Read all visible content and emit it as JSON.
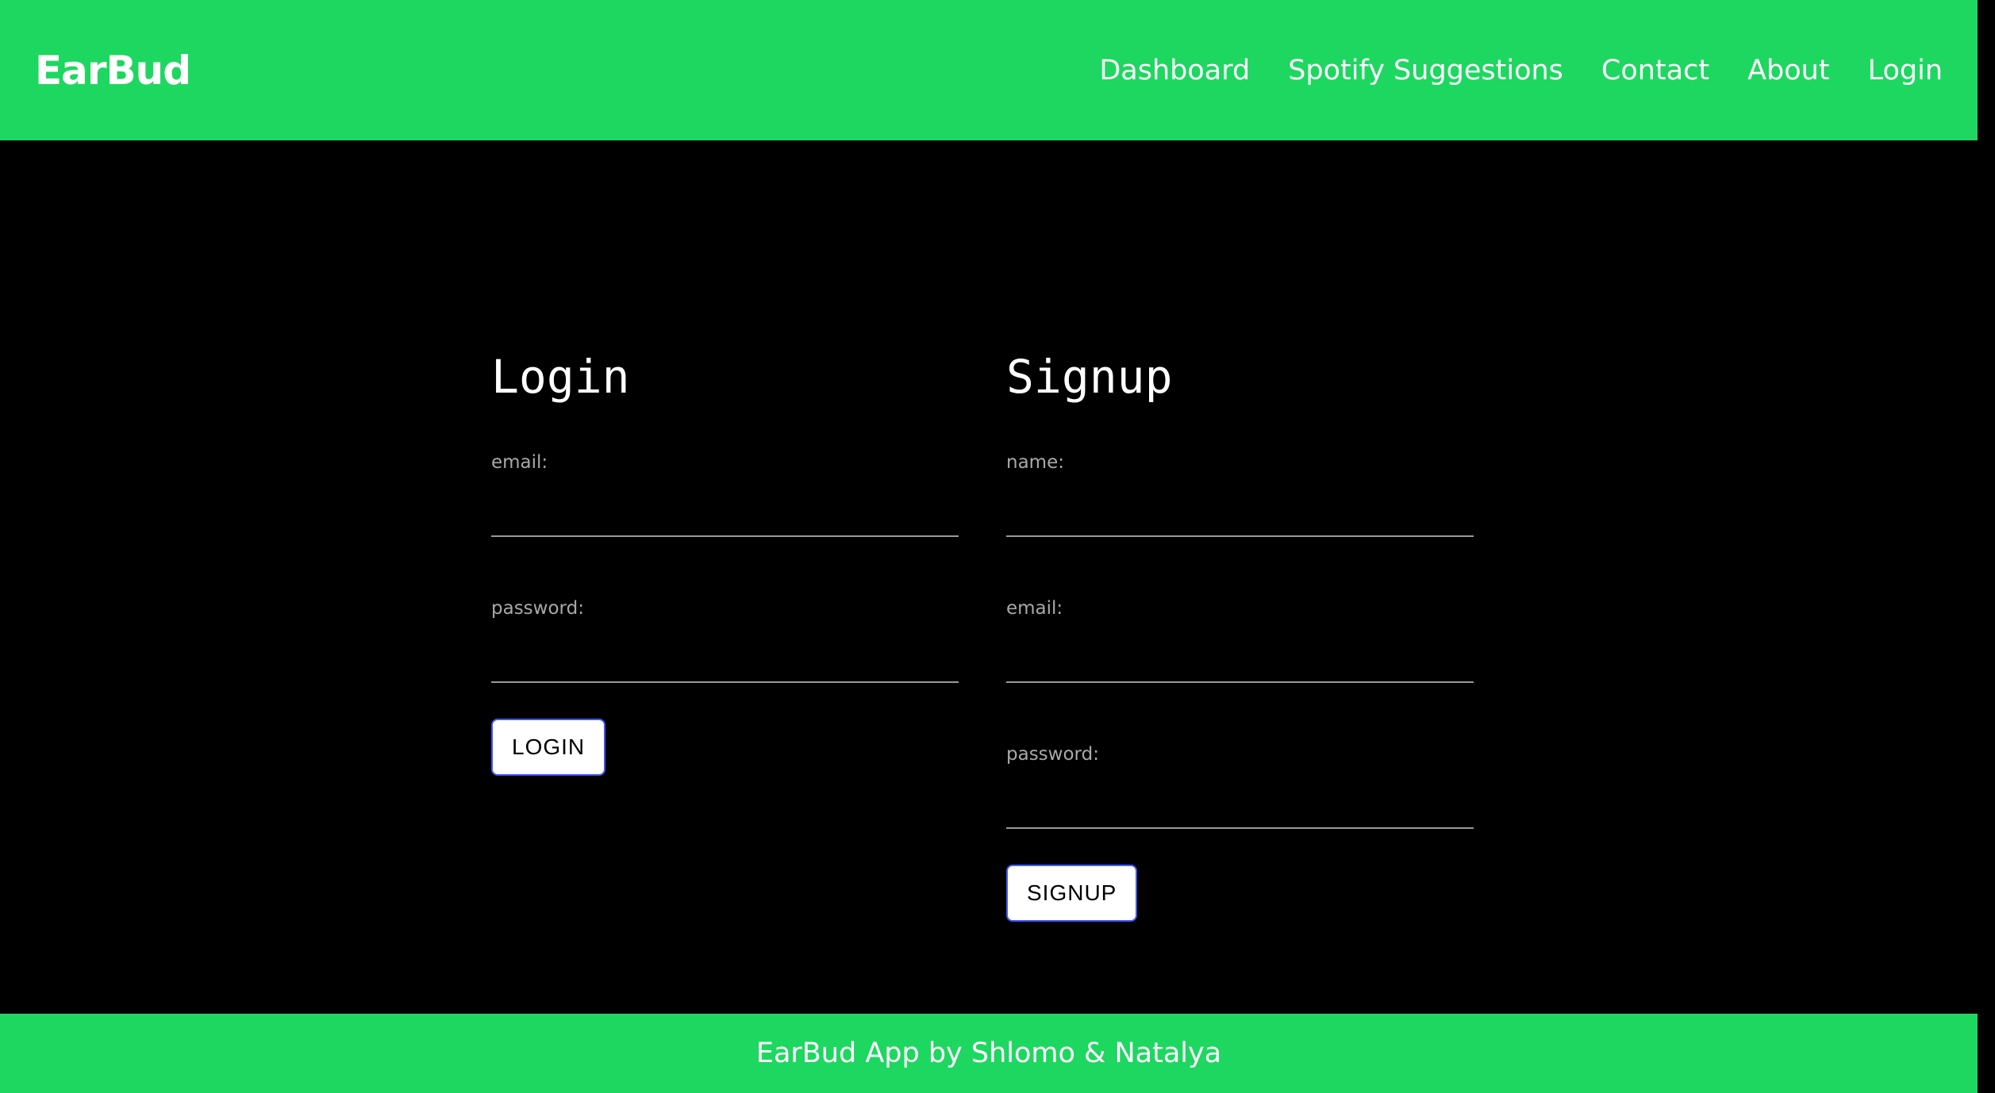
{
  "header": {
    "brand": "EarBud",
    "nav": [
      "Dashboard",
      "Spotify Suggestions",
      "Contact",
      "About",
      "Login"
    ]
  },
  "login_form": {
    "title": "Login",
    "email_label": "email:",
    "email_value": "",
    "password_label": "password:",
    "password_value": "",
    "button_label": "LOGIN"
  },
  "signup_form": {
    "title": "Signup",
    "name_label": "name:",
    "name_value": "",
    "email_label": "email:",
    "email_value": "",
    "password_label": "password:",
    "password_value": "",
    "button_label": "SIGNUP"
  },
  "footer": {
    "text": "EarBud App by Shlomo & Natalya"
  },
  "colors": {
    "brand_green": "#1ed760",
    "background": "#000000",
    "button_border": "#3d5afe"
  }
}
